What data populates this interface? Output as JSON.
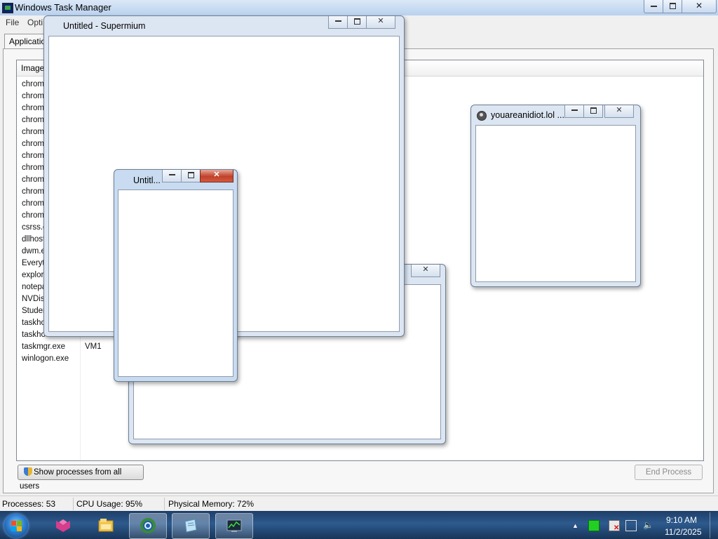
{
  "taskmgr": {
    "title": "Windows Task Manager",
    "menu": [
      "File",
      "Opti"
    ],
    "tab_label": "Application",
    "column_image": "Image",
    "processes": [
      {
        "name": "chrome",
        "user": ""
      },
      {
        "name": "chrome",
        "user": ""
      },
      {
        "name": "chrome",
        "user": ""
      },
      {
        "name": "chrome",
        "user": ""
      },
      {
        "name": "chrome",
        "user": ""
      },
      {
        "name": "chrome",
        "user": ""
      },
      {
        "name": "chrome",
        "user": ""
      },
      {
        "name": "chrome",
        "user": ""
      },
      {
        "name": "chrome",
        "user": ""
      },
      {
        "name": "chrome",
        "user": ""
      },
      {
        "name": "chrome",
        "user": ""
      },
      {
        "name": "chrome",
        "user": ""
      },
      {
        "name": "csrss.e",
        "user": ""
      },
      {
        "name": "dllhost",
        "user": ""
      },
      {
        "name": "dwm.e",
        "user": ""
      },
      {
        "name": "Everyt",
        "user": ""
      },
      {
        "name": "explor",
        "user": ""
      },
      {
        "name": "notepa",
        "user": ""
      },
      {
        "name": "NVDisp",
        "user": ""
      },
      {
        "name": "Studen",
        "user": ""
      },
      {
        "name": "taskho",
        "user": ""
      },
      {
        "name": "taskho",
        "user": ""
      },
      {
        "name": "taskmgr.exe",
        "user": "VM1"
      },
      {
        "name": "winlogon.exe",
        "user": ""
      }
    ],
    "show_all_label": "Show processes from all users",
    "end_process_label": "End Process",
    "status": {
      "processes": "Processes: 53",
      "cpu": "CPU Usage: 95%",
      "memory": "Physical Memory: 72%"
    }
  },
  "windows": {
    "supermium": {
      "title": "Untitled - Supermium"
    },
    "small": {
      "title": "Untitl..."
    },
    "idiot": {
      "title": "youareanidiot.lol ..."
    }
  },
  "taskbar": {
    "time": "9:10 AM",
    "date": "11/2/2025",
    "pinned": [
      "paint-app-icon",
      "file-explorer-icon",
      "supermium-browser-icon",
      "notepad-icon",
      "task-manager-icon"
    ]
  }
}
